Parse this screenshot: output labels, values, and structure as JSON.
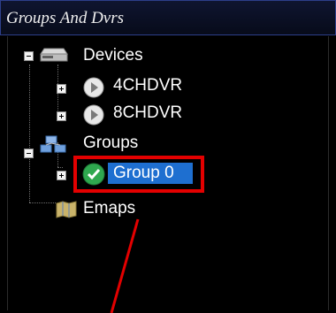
{
  "panel": {
    "title": "Groups And Dvrs"
  },
  "tree": {
    "devices": {
      "label": "Devices",
      "children": [
        {
          "label": "4CHDVR"
        },
        {
          "label": "8CHDVR"
        }
      ]
    },
    "groups": {
      "label": "Groups",
      "children": [
        {
          "label": "Group 0"
        }
      ]
    },
    "emaps": {
      "label": "Emaps"
    }
  },
  "colors": {
    "selection": "#1e6fd0",
    "highlight": "#e30000",
    "check": "#2fa84f"
  }
}
